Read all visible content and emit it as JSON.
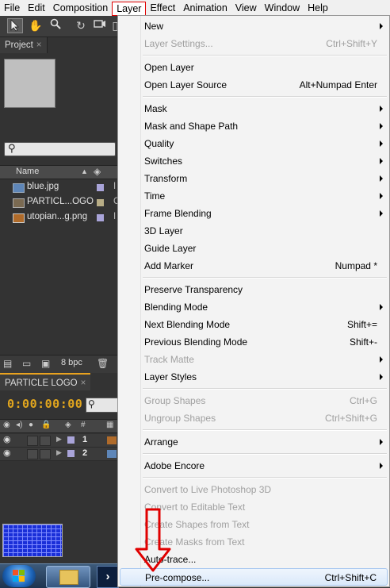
{
  "menubar": {
    "items": [
      "File",
      "Edit",
      "Composition",
      "Layer",
      "Effect",
      "Animation",
      "View",
      "Window",
      "Help"
    ],
    "active": "Layer"
  },
  "project": {
    "tab_label": "Project",
    "header_name": "Name",
    "items": [
      {
        "name": "blue.jpg",
        "icon": "image-icon",
        "label_color": "#a9a4d9"
      },
      {
        "name": "PARTICL...OGO",
        "icon": "composition-icon",
        "label_color": "#b8ad86"
      },
      {
        "name": "utopian...g.png",
        "icon": "image-icon",
        "label_color": "#a9a4d9"
      }
    ],
    "bit_depth": "8 bpc"
  },
  "timeline": {
    "tab_label": "PARTICLE LOGO",
    "timecode": "0:00:00:00",
    "rows": [
      {
        "num": "1"
      },
      {
        "num": "2"
      }
    ]
  },
  "menu": {
    "items": [
      {
        "label": "New",
        "shortcut": "",
        "submenu": true,
        "disabled": false
      },
      {
        "label": "Layer Settings...",
        "shortcut": "Ctrl+Shift+Y",
        "submenu": false,
        "disabled": true
      },
      {
        "label": "Open Layer",
        "shortcut": "",
        "submenu": false,
        "disabled": false
      },
      {
        "label": "Open Layer Source",
        "shortcut": "Alt+Numpad Enter",
        "submenu": false,
        "disabled": false
      },
      {
        "label": "Mask",
        "shortcut": "",
        "submenu": true,
        "disabled": false
      },
      {
        "label": "Mask and Shape Path",
        "shortcut": "",
        "submenu": true,
        "disabled": false
      },
      {
        "label": "Quality",
        "shortcut": "",
        "submenu": true,
        "disabled": false
      },
      {
        "label": "Switches",
        "shortcut": "",
        "submenu": true,
        "disabled": false
      },
      {
        "label": "Transform",
        "shortcut": "",
        "submenu": true,
        "disabled": false
      },
      {
        "label": "Time",
        "shortcut": "",
        "submenu": true,
        "disabled": false
      },
      {
        "label": "Frame Blending",
        "shortcut": "",
        "submenu": true,
        "disabled": false
      },
      {
        "label": "3D Layer",
        "shortcut": "",
        "submenu": false,
        "disabled": false
      },
      {
        "label": "Guide Layer",
        "shortcut": "",
        "submenu": false,
        "disabled": false
      },
      {
        "label": "Add Marker",
        "shortcut": "Numpad *",
        "submenu": false,
        "disabled": false
      },
      {
        "label": "Preserve Transparency",
        "shortcut": "",
        "submenu": false,
        "disabled": false
      },
      {
        "label": "Blending Mode",
        "shortcut": "",
        "submenu": true,
        "disabled": false
      },
      {
        "label": "Next Blending Mode",
        "shortcut": "Shift+=",
        "submenu": false,
        "disabled": false
      },
      {
        "label": "Previous Blending Mode",
        "shortcut": "Shift+-",
        "submenu": false,
        "disabled": false
      },
      {
        "label": "Track Matte",
        "shortcut": "",
        "submenu": true,
        "disabled": true
      },
      {
        "label": "Layer Styles",
        "shortcut": "",
        "submenu": true,
        "disabled": false
      },
      {
        "label": "Group Shapes",
        "shortcut": "Ctrl+G",
        "submenu": false,
        "disabled": true
      },
      {
        "label": "Ungroup Shapes",
        "shortcut": "Ctrl+Shift+G",
        "submenu": false,
        "disabled": true
      },
      {
        "label": "Arrange",
        "shortcut": "",
        "submenu": true,
        "disabled": false
      },
      {
        "label": "Adobe Encore",
        "shortcut": "",
        "submenu": true,
        "disabled": false
      },
      {
        "label": "Convert to Live Photoshop 3D",
        "shortcut": "",
        "submenu": false,
        "disabled": true
      },
      {
        "label": "Convert to Editable Text",
        "shortcut": "",
        "submenu": false,
        "disabled": true
      },
      {
        "label": "Create Shapes from Text",
        "shortcut": "",
        "submenu": false,
        "disabled": true
      },
      {
        "label": "Create Masks from Text",
        "shortcut": "",
        "submenu": false,
        "disabled": true
      },
      {
        "label": "Auto-trace...",
        "shortcut": "",
        "submenu": false,
        "disabled": false
      },
      {
        "label": "Pre-compose...",
        "shortcut": "Ctrl+Shift+C",
        "submenu": false,
        "disabled": false,
        "highlighted": true
      }
    ]
  },
  "colors": {
    "timecode": "#e0a51e",
    "active_menu_border": "#e00000",
    "annotation_arrow": "#e00000"
  }
}
